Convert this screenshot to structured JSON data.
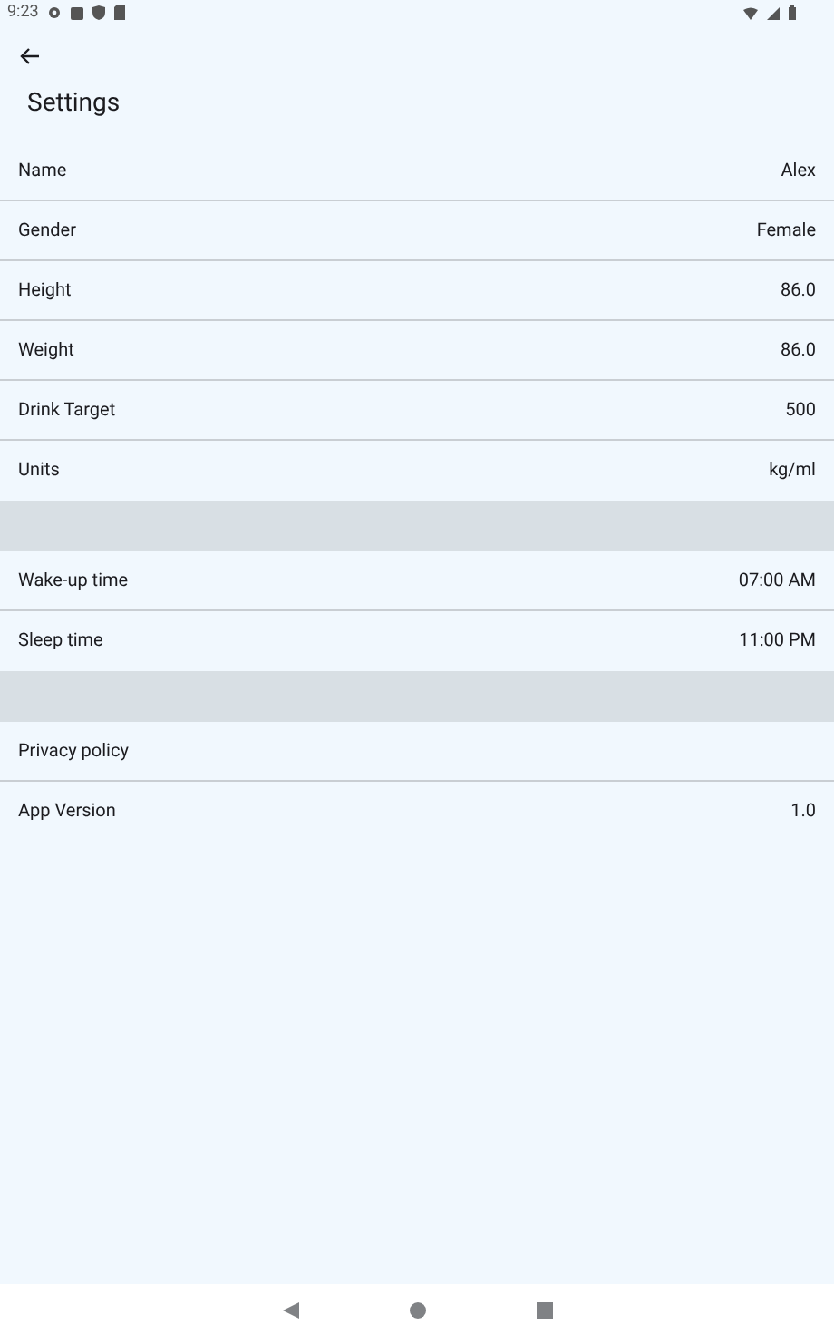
{
  "status_bar": {
    "time": "9:23"
  },
  "title": "Settings",
  "sections": [
    [
      {
        "label": "Name",
        "value": "Alex"
      },
      {
        "label": "Gender",
        "value": "Female"
      },
      {
        "label": "Height",
        "value": "86.0"
      },
      {
        "label": "Weight",
        "value": "86.0"
      },
      {
        "label": "Drink Target",
        "value": "500"
      },
      {
        "label": "Units",
        "value": "kg/ml"
      }
    ],
    [
      {
        "label": "Wake-up time",
        "value": "07:00 AM"
      },
      {
        "label": "Sleep time",
        "value": "11:00 PM"
      }
    ],
    [
      {
        "label": "Privacy policy"
      },
      {
        "label": "App Version",
        "value": "1.0"
      }
    ]
  ]
}
